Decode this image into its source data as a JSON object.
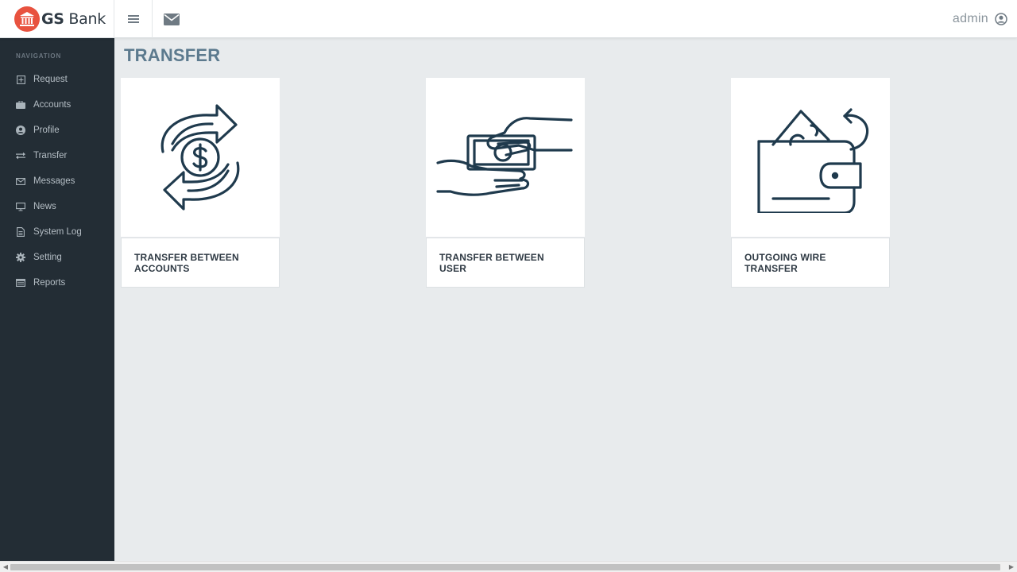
{
  "brand": {
    "name_bold": "GS",
    "name_rest": " Bank"
  },
  "topbar": {
    "user_name": "admin"
  },
  "sidebar": {
    "heading": "NAVIGATION",
    "items": [
      {
        "label": "Request",
        "icon": "plus-square-icon"
      },
      {
        "label": "Accounts",
        "icon": "briefcase-icon"
      },
      {
        "label": "Profile",
        "icon": "user-circle-icon"
      },
      {
        "label": "Transfer",
        "icon": "exchange-icon"
      },
      {
        "label": "Messages",
        "icon": "envelope-icon"
      },
      {
        "label": "News",
        "icon": "monitor-icon"
      },
      {
        "label": "System Log",
        "icon": "file-icon"
      },
      {
        "label": "Setting",
        "icon": "gear-icon"
      },
      {
        "label": "Reports",
        "icon": "list-icon"
      }
    ]
  },
  "main": {
    "title": "TRANSFER",
    "cards": [
      {
        "label": "TRANSFER BETWEEN ACCOUNTS",
        "icon": "money-exchange-icon"
      },
      {
        "label": "TRANSFER BETWEEN USER",
        "icon": "hand-cash-icon"
      },
      {
        "label": "OUTGOING WIRE TRANSFER",
        "icon": "wallet-icon"
      }
    ]
  },
  "colors": {
    "sidebar_bg": "#232d35",
    "brand_red": "#e8523f",
    "title": "#5c7a8e",
    "icon_stroke": "#1f3a4d",
    "page_bg": "#e8ebed"
  }
}
